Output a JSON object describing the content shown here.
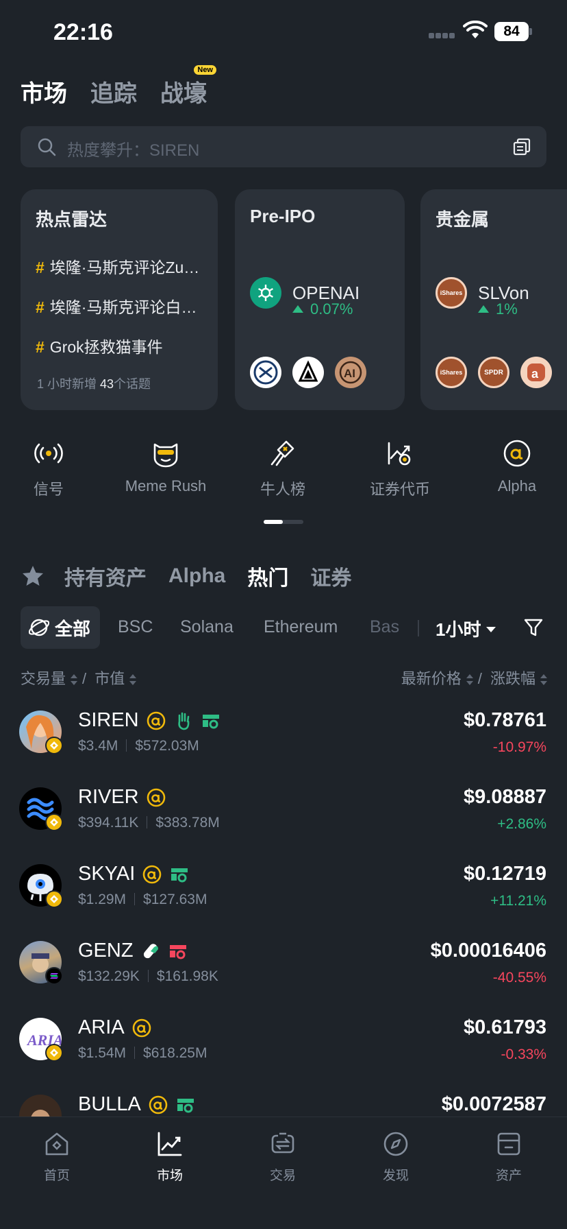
{
  "status_bar": {
    "time": "22:16",
    "battery": "84"
  },
  "top_tabs": [
    {
      "label": "市场",
      "active": true
    },
    {
      "label": "追踪",
      "active": false
    },
    {
      "label": "战壕",
      "active": false,
      "badge": "New"
    }
  ],
  "search": {
    "placeholder": "热度攀升：SIREN"
  },
  "cards": {
    "hot_radar": {
      "title": "热点雷达",
      "topics": [
        "埃隆·马斯克评论Zu…",
        "埃隆·马斯克评论白…",
        "Grok拯救猫事件"
      ],
      "footer_prefix": "1 小时新增 ",
      "footer_count": "43",
      "footer_suffix": "个话题"
    },
    "pre_ipo": {
      "title": "Pre-IPO",
      "asset": "OPENAI",
      "change": "0.07%"
    },
    "precious_metals": {
      "title": "贵金属",
      "asset": "SLVon",
      "change": "1%",
      "logo_labels": [
        "iShares",
        "SPDR"
      ]
    }
  },
  "shortcuts": [
    {
      "label": "信号",
      "icon": "signal-icon"
    },
    {
      "label": "Meme Rush",
      "icon": "meme-rush-icon"
    },
    {
      "label": "牛人榜",
      "icon": "leaderboard-icon"
    },
    {
      "label": "证券代币",
      "icon": "securities-token-icon"
    },
    {
      "label": "Alpha",
      "icon": "alpha-icon"
    }
  ],
  "category_tabs": [
    {
      "label": "持有资产",
      "active": false
    },
    {
      "label": "Alpha",
      "active": false
    },
    {
      "label": "热门",
      "active": true
    },
    {
      "label": "证券",
      "active": false
    }
  ],
  "chain_filters": {
    "all": "全部",
    "chains": [
      "BSC",
      "Solana",
      "Ethereum",
      "Bas"
    ],
    "time": "1小时"
  },
  "sort_header": {
    "left_a": "交易量",
    "left_b": "市值",
    "right_a": "最新价格",
    "right_b": "涨跌幅",
    "slash": "/"
  },
  "tokens": [
    {
      "symbol": "SIREN",
      "volume": "$3.4M",
      "mcap": "$572.03M",
      "price": "$0.78761",
      "change": "-10.97%",
      "dir": "down"
    },
    {
      "symbol": "RIVER",
      "volume": "$394.11K",
      "mcap": "$383.78M",
      "price": "$9.08887",
      "change": "+2.86%",
      "dir": "up"
    },
    {
      "symbol": "SKYAI",
      "volume": "$1.29M",
      "mcap": "$127.63M",
      "price": "$0.12719",
      "change": "+11.21%",
      "dir": "up"
    },
    {
      "symbol": "GENZ",
      "volume": "$132.29K",
      "mcap": "$161.98K",
      "price": "$0.00016406",
      "change": "-40.55%",
      "dir": "down"
    },
    {
      "symbol": "ARIA",
      "volume": "$1.54M",
      "mcap": "$618.25M",
      "price": "$0.61793",
      "change": "-0.33%",
      "dir": "down"
    },
    {
      "symbol": "BULLA",
      "volume": "",
      "mcap": "",
      "price": "$0.0072587",
      "change": "",
      "dir": "up"
    }
  ],
  "bottom_nav": [
    {
      "label": "首页",
      "active": false
    },
    {
      "label": "市场",
      "active": true
    },
    {
      "label": "交易",
      "active": false
    },
    {
      "label": "发现",
      "active": false
    },
    {
      "label": "资产",
      "active": false
    }
  ],
  "colors": {
    "bg": "#1e2329",
    "card": "#2b3139",
    "up": "#2ebd85",
    "down": "#f6465d",
    "brand": "#f0b90b"
  }
}
